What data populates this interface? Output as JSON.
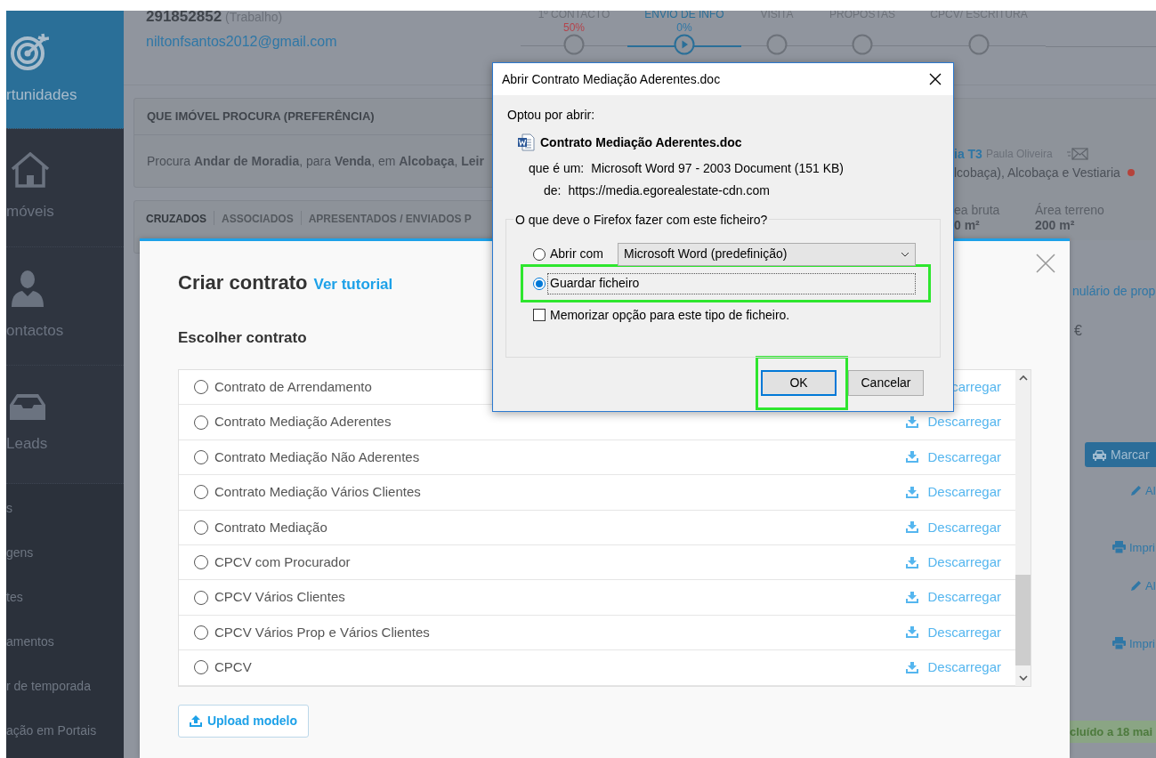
{
  "sidebar": {
    "items": [
      {
        "kind": "target",
        "label": "rtunidades",
        "selected": true
      },
      {
        "kind": "house",
        "label": "móveis",
        "selected": false
      },
      {
        "kind": "person",
        "label": "ontactos",
        "selected": false
      },
      {
        "kind": "inbox",
        "label": "Leads",
        "selected": false
      }
    ],
    "submenu": [
      "s",
      "gens",
      "tes",
      "amentos",
      "r de temporada",
      "ação em Portais"
    ]
  },
  "contact": {
    "phone": "291852852",
    "phone_type": "(Trabalho)",
    "email": "niltonfsantos2012@gmail.com"
  },
  "pipeline": [
    {
      "label": "1º CONTACTO",
      "percent": "50%",
      "selected": false
    },
    {
      "label": "ENVIO DE INFO",
      "percent": "0%",
      "selected": true
    },
    {
      "label": "VISITA",
      "selected": false
    },
    {
      "label": "PROPOSTAS",
      "selected": false
    },
    {
      "label": "CPCV/ ESCRITURA",
      "selected": false
    }
  ],
  "preference_card": {
    "title": "QUE IMÓVEL PROCURA (PREFERÊNCIA)",
    "text": "Procura **Andar de Moradia**, para **Venda**, em **Alcobaça**, **Leir**"
  },
  "tabs": [
    {
      "label": "CRUZADOS",
      "selected": true
    },
    {
      "label": "ASSOCIADOS",
      "selected": false
    },
    {
      "label": "APRESENTADOS / ENVIADOS P",
      "selected": false
    }
  ],
  "property_card": {
    "title": "ia T3",
    "agent": "Paula Oliveira",
    "location": "lcobaça), Alcobaça e Vestiaria",
    "stats": [
      {
        "label": "ea bruta",
        "value": "0 m²"
      },
      {
        "label": "Área terreno",
        "value": "200 m²"
      }
    ]
  },
  "side_panel": {
    "link": "nulário de prop",
    "price": "€",
    "visit_button": "Marcar",
    "actions": [
      {
        "kind": "edit",
        "label": "Al"
      },
      {
        "kind": "print",
        "label": "Impri"
      },
      {
        "kind": "edit",
        "label": "Al"
      },
      {
        "kind": "print",
        "label": "Impri"
      }
    ],
    "notice": "cluído a 18 mai"
  },
  "modal": {
    "title": "Criar contrato",
    "tutorial_link": "Ver tutorial",
    "section_title": "Escolher contrato",
    "contracts": [
      {
        "name": "Contrato de Arrendamento",
        "download": "carregar",
        "icon": false,
        "selected": false
      },
      {
        "name": "Contrato Mediação Aderentes",
        "download": "Descarregar",
        "icon": true,
        "selected": false
      },
      {
        "name": "Contrato Mediação Não Aderentes",
        "download": "Descarregar",
        "icon": true,
        "selected": false
      },
      {
        "name": "Contrato Mediação Vários Clientes",
        "download": "Descarregar",
        "icon": true,
        "selected": false
      },
      {
        "name": "Contrato Mediação",
        "download": "Descarregar",
        "icon": true,
        "selected": false
      },
      {
        "name": "CPCV com Procurador",
        "download": "Descarregar",
        "icon": true,
        "selected": false
      },
      {
        "name": "CPCV Vários Clientes",
        "download": "Descarregar",
        "icon": true,
        "selected": false
      },
      {
        "name": "CPCV Vários Prop e Vários Clientes",
        "download": "Descarregar",
        "icon": true,
        "selected": false
      },
      {
        "name": "CPCV",
        "download": "Descarregar",
        "icon": true,
        "selected": false
      }
    ],
    "upload_button": "Upload modelo"
  },
  "dialog": {
    "title": "Abrir Contrato Mediação Aderentes.doc",
    "intro": "Optou por abrir:",
    "file_name": "Contrato Mediação Aderentes.doc",
    "type_label": "que é um:",
    "type_value": "Microsoft Word 97 - 2003 Document (151 KB)",
    "source_label": "de:",
    "source_value": "https://media.egorealestate-cdn.com",
    "group_title": "O que deve o Firefox fazer com este ficheiro?",
    "options": [
      {
        "label": "Abrir com",
        "selected": false,
        "highlighted": false,
        "app": "Microsoft Word (predefinição)"
      },
      {
        "label": "Guardar ficheiro",
        "selected": true,
        "highlighted": true
      }
    ],
    "remember": {
      "label": "Memorizar opção para este tipo de ficheiro.",
      "checked": false
    },
    "buttons": [
      {
        "label": "OK",
        "default": true,
        "highlighted": true
      },
      {
        "label": "Cancelar",
        "default": false,
        "highlighted": false
      }
    ]
  }
}
